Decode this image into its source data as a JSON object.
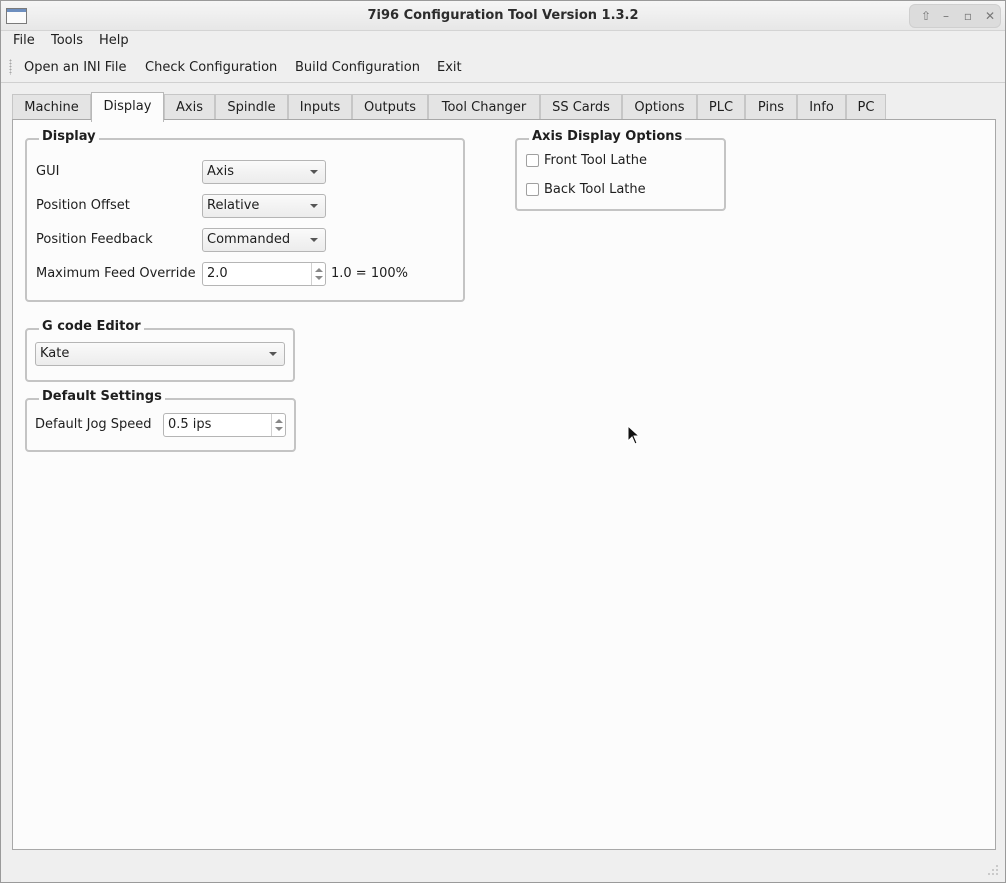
{
  "window": {
    "title": "7i96 Configuration Tool Version 1.3.2"
  },
  "menubar": {
    "items": [
      "File",
      "Tools",
      "Help"
    ]
  },
  "toolbar": {
    "buttons": [
      "Open an INI File",
      "Check Configuration",
      "Build Configuration",
      "Exit"
    ]
  },
  "tabs": {
    "items": [
      "Machine",
      "Display",
      "Axis",
      "Spindle",
      "Inputs",
      "Outputs",
      "Tool Changer",
      "SS Cards",
      "Options",
      "PLC",
      "Pins",
      "Info",
      "PC"
    ],
    "selected": "Display"
  },
  "display_group": {
    "title": "Display",
    "gui": {
      "label": "GUI",
      "value": "Axis"
    },
    "position_offset": {
      "label": "Position Offset",
      "value": "Relative"
    },
    "position_feedback": {
      "label": "Position Feedback",
      "value": "Commanded"
    },
    "max_feed_override": {
      "label": "Maximum Feed Override",
      "value": "2.0",
      "note": "1.0 = 100%"
    }
  },
  "axis_display_options": {
    "title": "Axis Display Options",
    "front_tool_lathe": {
      "label": "Front Tool Lathe",
      "checked": false
    },
    "back_tool_lathe": {
      "label": "Back Tool Lathe",
      "checked": false
    }
  },
  "gcode_editor": {
    "title": "G code Editor",
    "value": "Kate"
  },
  "default_settings": {
    "title": "Default Settings",
    "jog_speed": {
      "label": "Default Jog Speed",
      "value": "0.5 ips"
    }
  },
  "icons": {
    "window_buttons": [
      "shade-icon",
      "minimize-icon",
      "maximize-icon",
      "close-icon"
    ]
  }
}
